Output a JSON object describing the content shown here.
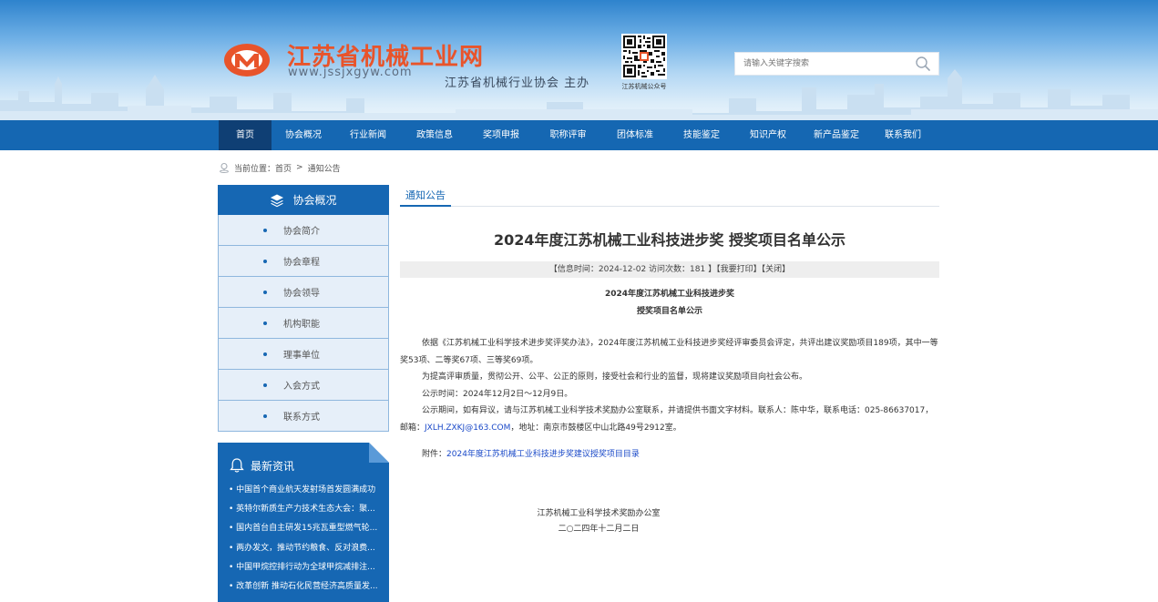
{
  "header": {
    "site_name": "江苏省机械工业网",
    "site_url": "www.jssjxgyw.com",
    "organizer": "江苏省机械行业协会 主办",
    "qr_label": "江苏机械公众号",
    "search_placeholder": "请输入关键字搜索"
  },
  "nav": {
    "items": [
      {
        "label": "首页",
        "active": true
      },
      {
        "label": "协会概况"
      },
      {
        "label": "行业新闻"
      },
      {
        "label": "政策信息"
      },
      {
        "label": "奖项申报"
      },
      {
        "label": "职称评审"
      },
      {
        "label": "团体标准"
      },
      {
        "label": "技能鉴定"
      },
      {
        "label": "知识产权"
      },
      {
        "label": "新产品鉴定"
      },
      {
        "label": "联系我们"
      }
    ]
  },
  "breadcrumb": {
    "prefix": "当前位置：",
    "home": "首页",
    "sep": ">",
    "current": "通知公告"
  },
  "sidebar": {
    "title": "协会概况",
    "items": [
      {
        "label": "协会简介"
      },
      {
        "label": "协会章程"
      },
      {
        "label": "协会领导"
      },
      {
        "label": "机构职能"
      },
      {
        "label": "理事单位"
      },
      {
        "label": "入会方式"
      },
      {
        "label": "联系方式"
      }
    ]
  },
  "news": {
    "title": "最新资讯",
    "items": [
      {
        "label": "中国首个商业航天发射场首发圆满成功"
      },
      {
        "label": "英特尔新质生产力技术生态大会：聚..."
      },
      {
        "label": "国内首台自主研发15兆瓦重型燃气轮..."
      },
      {
        "label": "两办发文，推动节约粮食、反对浪费..."
      },
      {
        "label": "中国甲烷控排行动为全球甲烷减排注..."
      },
      {
        "label": "改革创新 推动石化民营经济高质量发..."
      }
    ]
  },
  "article": {
    "tab": "通知公告",
    "title": "2024年度江苏机械工业科技进步奖 授奖项目名单公示",
    "meta": "【信息时间：2024-12-02  访问次数：181 】【我要打印】【关闭】",
    "subtitle1": "2024年度江苏机械工业科技进步奖",
    "subtitle2": "授奖项目名单公示",
    "p1": "依据《江苏机械工业科学技术进步奖评奖办法》，2024年度江苏机械工业科技进步奖经评审委员会评定，共评出建议奖励项目189项，其中一等奖53项、二等奖67项、三等奖69项。",
    "p2": "为提高评审质量，贯彻公开、公平、公正的原则，接受社会和行业的监督，现将建议奖励项目向社会公布。",
    "p3": "公示时间：2024年12月2日～12月9日。",
    "p4_before": "公示期间，如有异议，请与江苏机械工业科学技术奖励办公室联系，并请提供书面文字材料。联系人：陈中华，联系电话：025-86637017，邮箱：",
    "p4_email": "JXLH.ZXKJ@163.COM",
    "p4_after": "，地址：南京市鼓楼区中山北路49号2912室。",
    "attach_label": "附件：",
    "attach_link": "2024年度江苏机械工业科技进步奖建议授奖项目目录",
    "sign_org": "江苏机械工业科学技术奖励办公室",
    "sign_date": "二○二四年十二月二日"
  }
}
